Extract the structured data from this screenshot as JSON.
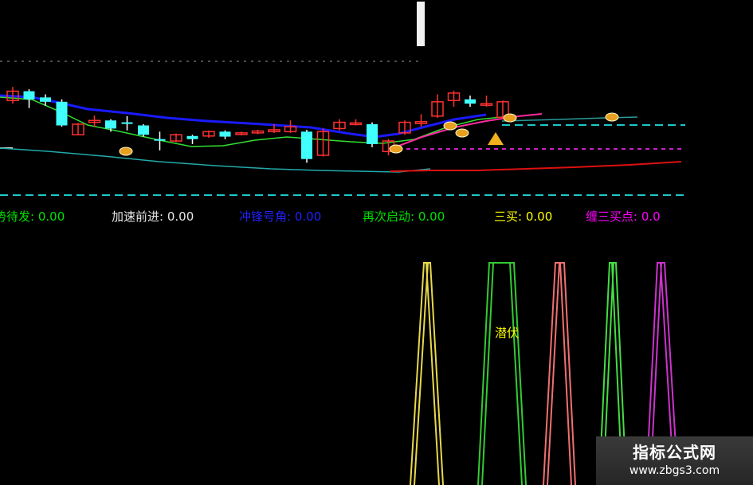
{
  "legend": [
    {
      "label": "蓄势待发",
      "value": "0.00",
      "color": "#00e000"
    },
    {
      "label": "加速前进",
      "value": "0.00",
      "color": "#e6e6e6"
    },
    {
      "label": "冲锋号角",
      "value": "0.00",
      "color": "#2020ff"
    },
    {
      "label": "再次启动",
      "value": "0.00",
      "color": "#00e000"
    },
    {
      "label": "三买",
      "value": "0.00",
      "color": "#ffff00"
    },
    {
      "label": "缠三买点",
      "value": "0.0",
      "color": "#ff00ff"
    }
  ],
  "annotation": {
    "text": "潜伏",
    "color": "#ffff00"
  },
  "watermark": {
    "title": "指标公式网",
    "url": "www.zbgs3.com"
  },
  "colors": {
    "up": "#ff3030",
    "down": "#40ffff",
    "ma_blue": "#1a1aff",
    "ma_green": "#33dd33",
    "ma_magenta": "#ff2aa0",
    "ma_teal": "#22aaaa",
    "ma_red": "#dd1010",
    "dash": "#1ec8c8"
  },
  "chart_data": [
    {
      "type": "candlestick",
      "candles": [
        {
          "o": 100.0,
          "c": 101.5,
          "h": 102.2,
          "l": 99.5
        },
        {
          "o": 101.5,
          "c": 100.2,
          "h": 101.8,
          "l": 98.8
        },
        {
          "o": 100.5,
          "c": 99.8,
          "h": 101.0,
          "l": 99.2
        },
        {
          "o": 99.8,
          "c": 96.0,
          "h": 100.2,
          "l": 95.8
        },
        {
          "o": 94.5,
          "c": 96.2,
          "h": 96.4,
          "l": 94.4
        },
        {
          "o": 96.5,
          "c": 96.8,
          "h": 97.6,
          "l": 95.8
        },
        {
          "o": 96.8,
          "c": 95.5,
          "h": 97.0,
          "l": 95.0
        },
        {
          "o": 96.5,
          "c": 96.4,
          "h": 97.5,
          "l": 95.2
        },
        {
          "o": 96.0,
          "c": 94.5,
          "h": 96.2,
          "l": 94.2
        },
        {
          "o": 93.8,
          "c": 93.6,
          "h": 95.0,
          "l": 92.0
        },
        {
          "o": 93.5,
          "c": 94.5,
          "h": 94.7,
          "l": 93.3
        },
        {
          "o": 94.3,
          "c": 93.8,
          "h": 94.5,
          "l": 93.0
        },
        {
          "o": 94.3,
          "c": 95.0,
          "h": 95.2,
          "l": 94.0
        },
        {
          "o": 95.0,
          "c": 94.2,
          "h": 95.2,
          "l": 93.8
        },
        {
          "o": 94.6,
          "c": 94.8,
          "h": 95.0,
          "l": 94.4
        },
        {
          "o": 94.8,
          "c": 95.1,
          "h": 95.3,
          "l": 94.6
        },
        {
          "o": 95.0,
          "c": 95.3,
          "h": 96.2,
          "l": 94.8
        },
        {
          "o": 95.0,
          "c": 95.8,
          "h": 96.8,
          "l": 94.8
        },
        {
          "o": 95.0,
          "c": 90.6,
          "h": 95.3,
          "l": 90.0
        },
        {
          "o": 91.2,
          "c": 95.0,
          "h": 95.5,
          "l": 91.0
        },
        {
          "o": 95.5,
          "c": 96.5,
          "h": 97.0,
          "l": 95.2
        },
        {
          "o": 96.3,
          "c": 96.4,
          "h": 97.0,
          "l": 96.0
        },
        {
          "o": 96.2,
          "c": 93.0,
          "h": 96.5,
          "l": 92.5
        },
        {
          "o": 91.8,
          "c": 93.5,
          "h": 93.8,
          "l": 91.2
        },
        {
          "o": 94.8,
          "c": 96.5,
          "h": 96.8,
          "l": 94.5
        },
        {
          "o": 96.3,
          "c": 96.6,
          "h": 97.8,
          "l": 95.8
        },
        {
          "o": 97.5,
          "c": 99.8,
          "h": 101.0,
          "l": 97.2
        },
        {
          "o": 100.0,
          "c": 101.2,
          "h": 101.6,
          "l": 99.0
        },
        {
          "o": 100.2,
          "c": 99.5,
          "h": 100.8,
          "l": 99.0
        },
        {
          "o": 99.3,
          "c": 99.5,
          "h": 100.8,
          "l": 99.0
        },
        {
          "o": 97.3,
          "c": 99.8,
          "h": 100.0,
          "l": 97.0
        }
      ],
      "ylim": [
        88,
        104
      ]
    },
    {
      "type": "line",
      "series": [
        {
          "color": "#e8d84a",
          "x": [
            515,
            532,
            540,
            556
          ],
          "y": [
            0,
            100,
            100,
            0
          ]
        },
        {
          "color": "#33cc33",
          "x": [
            600,
            614,
            625,
            636,
            645,
            660
          ],
          "y": [
            0,
            100,
            100,
            100,
            100,
            0
          ]
        },
        {
          "color": "#f07070",
          "x": [
            682,
            697,
            708,
            722
          ],
          "y": [
            0,
            100,
            100,
            0
          ]
        },
        {
          "color": "#44dd44",
          "x": [
            752,
            765,
            773,
            786
          ],
          "y": [
            0,
            100,
            100,
            0
          ]
        },
        {
          "color": "#cc33cc",
          "x": [
            811,
            825,
            834,
            851
          ],
          "y": [
            0,
            100,
            100,
            0
          ]
        }
      ],
      "ylim": [
        0,
        100
      ]
    }
  ]
}
